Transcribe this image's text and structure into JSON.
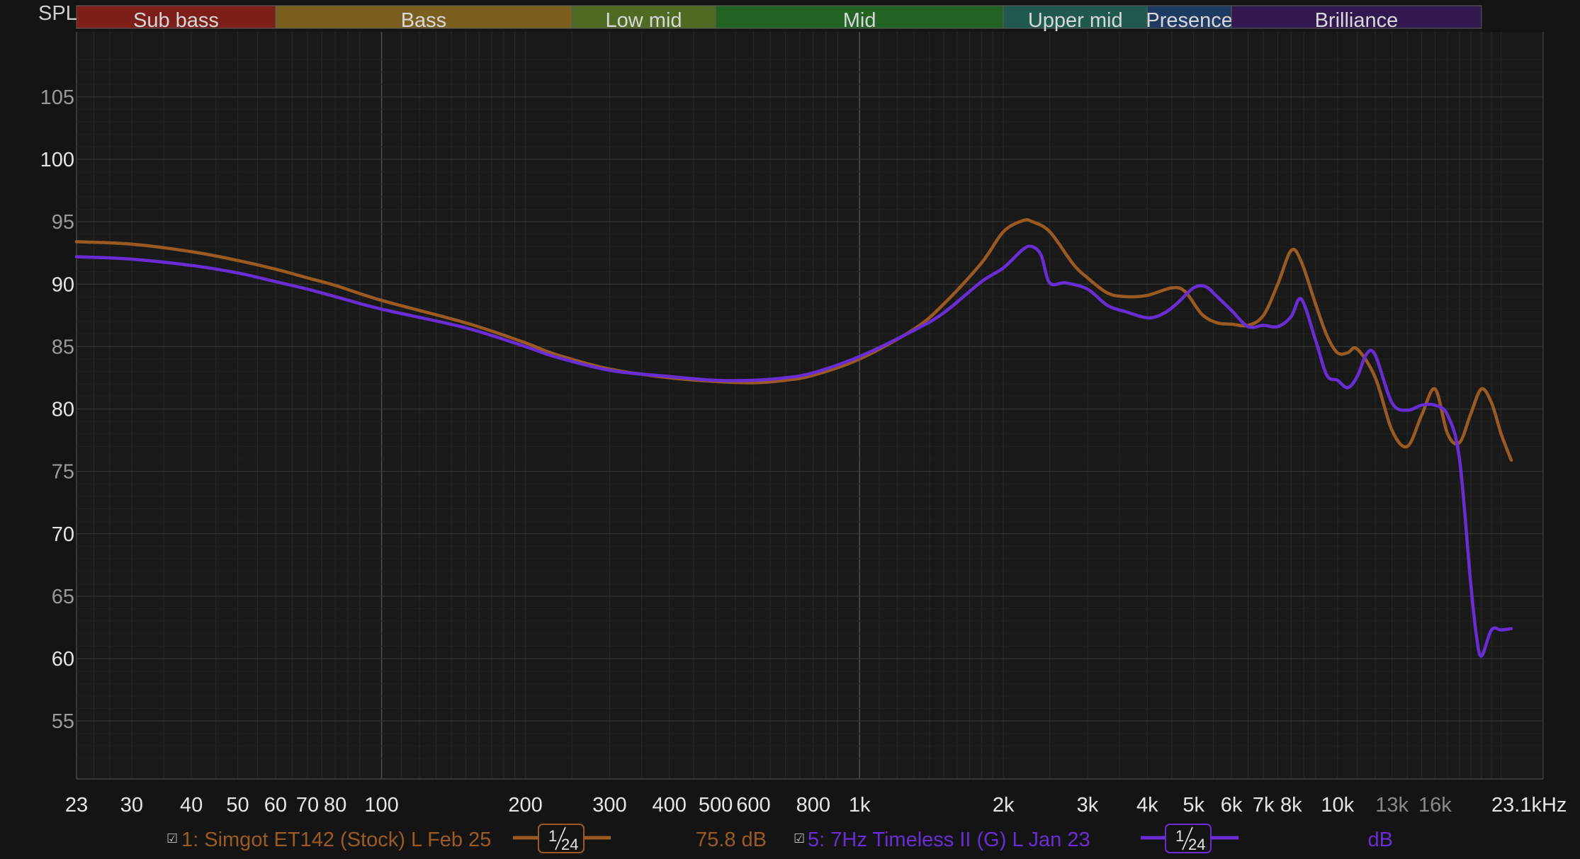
{
  "chart_data": {
    "type": "line",
    "ylabel": "SPL",
    "x_scale": "log",
    "xlim": [
      23,
      23100
    ],
    "ylim": [
      50,
      110
    ],
    "grid": true,
    "y_ticks": [
      {
        "value": 105,
        "label": "105",
        "bright": false
      },
      {
        "value": 100,
        "label": "100",
        "bright": true
      },
      {
        "value": 95,
        "label": "95",
        "bright": false
      },
      {
        "value": 90,
        "label": "90",
        "bright": true
      },
      {
        "value": 85,
        "label": "85",
        "bright": false
      },
      {
        "value": 80,
        "label": "80",
        "bright": true
      },
      {
        "value": 75,
        "label": "75",
        "bright": false
      },
      {
        "value": 70,
        "label": "70",
        "bright": true
      },
      {
        "value": 65,
        "label": "65",
        "bright": false
      },
      {
        "value": 60,
        "label": "60",
        "bright": true
      },
      {
        "value": 55,
        "label": "55",
        "bright": false
      }
    ],
    "x_ticks": [
      {
        "value": 23,
        "label": "23",
        "dim": false
      },
      {
        "value": 30,
        "label": "30",
        "dim": false
      },
      {
        "value": 40,
        "label": "40",
        "dim": false
      },
      {
        "value": 50,
        "label": "50",
        "dim": false
      },
      {
        "value": 60,
        "label": "60",
        "dim": false
      },
      {
        "value": 70,
        "label": "70",
        "dim": false
      },
      {
        "value": 80,
        "label": "80",
        "dim": false
      },
      {
        "value": 100,
        "label": "100",
        "dim": false
      },
      {
        "value": 200,
        "label": "200",
        "dim": false
      },
      {
        "value": 300,
        "label": "300",
        "dim": false
      },
      {
        "value": 400,
        "label": "400",
        "dim": false
      },
      {
        "value": 500,
        "label": "500",
        "dim": false
      },
      {
        "value": 600,
        "label": "600",
        "dim": false
      },
      {
        "value": 800,
        "label": "800",
        "dim": false
      },
      {
        "value": 1000,
        "label": "1k",
        "dim": false
      },
      {
        "value": 2000,
        "label": "2k",
        "dim": false
      },
      {
        "value": 3000,
        "label": "3k",
        "dim": false
      },
      {
        "value": 4000,
        "label": "4k",
        "dim": false
      },
      {
        "value": 5000,
        "label": "5k",
        "dim": false
      },
      {
        "value": 6000,
        "label": "6k",
        "dim": false
      },
      {
        "value": 7000,
        "label": "7k",
        "dim": false
      },
      {
        "value": 8000,
        "label": "8k",
        "dim": false
      },
      {
        "value": 10000,
        "label": "10k",
        "dim": false
      },
      {
        "value": 13000,
        "label": "13k",
        "dim": true
      },
      {
        "value": 16000,
        "label": "16k",
        "dim": true
      },
      {
        "value": 23100,
        "label": "23.1kHz",
        "dim": false
      }
    ],
    "bands": [
      {
        "name": "Sub bass",
        "from": 23,
        "to": 60,
        "color": "#7c1f18"
      },
      {
        "name": "Bass",
        "from": 60,
        "to": 250,
        "color": "#7a5f1f"
      },
      {
        "name": "Low mid",
        "from": 250,
        "to": 500,
        "color": "#4f6a23"
      },
      {
        "name": "Mid",
        "from": 500,
        "to": 2000,
        "color": "#236323"
      },
      {
        "name": "Upper mid",
        "from": 2000,
        "to": 4000,
        "color": "#205a4e"
      },
      {
        "name": "Presence",
        "from": 4000,
        "to": 6000,
        "color": "#1f3a63"
      },
      {
        "name": "Brilliance",
        "from": 6000,
        "to": 20000,
        "color": "#33184f"
      }
    ],
    "series": [
      {
        "name": "1: Simgot ET142 (Stock) L Feb 25",
        "color": "#9a5a22",
        "smoothing": "1/24",
        "level": "75.8 dB",
        "x": [
          23,
          30,
          40,
          50,
          60,
          70,
          80,
          100,
          150,
          200,
          230,
          300,
          400,
          500,
          600,
          700,
          800,
          1000,
          1300,
          1500,
          1800,
          2000,
          2200,
          2300,
          2500,
          2800,
          3000,
          3300,
          3600,
          4000,
          4500,
          4800,
          5200,
          5600,
          6000,
          6500,
          7000,
          7500,
          8000,
          8400,
          9000,
          9500,
          10000,
          10500,
          11000,
          12000,
          13000,
          14000,
          15000,
          16000,
          17000,
          18000,
          19000,
          20000,
          21000,
          22000,
          23100
        ],
        "y": [
          93.4,
          93.2,
          92.6,
          91.9,
          91.2,
          90.5,
          89.9,
          88.7,
          86.9,
          85.3,
          84.4,
          83.2,
          82.5,
          82.2,
          82.1,
          82.3,
          82.7,
          84.0,
          86.4,
          88.4,
          91.7,
          94.2,
          95.1,
          95.0,
          94.2,
          91.6,
          90.5,
          89.3,
          89.0,
          89.1,
          89.7,
          89.4,
          87.6,
          86.9,
          86.8,
          86.7,
          87.5,
          90.0,
          92.7,
          91.8,
          88.4,
          85.9,
          84.5,
          84.5,
          84.8,
          82.5,
          78.3,
          77.0,
          79.5,
          81.6,
          78.0,
          77.3,
          79.6,
          81.6,
          80.5,
          78.0,
          75.9
        ]
      },
      {
        "name": "5: 7Hz Timeless II (G) L Jan 23",
        "color": "#6a2dd4",
        "smoothing": "1/24",
        "level": "dB",
        "x": [
          23,
          30,
          40,
          50,
          60,
          70,
          80,
          100,
          150,
          200,
          230,
          300,
          400,
          500,
          600,
          700,
          800,
          1000,
          1300,
          1500,
          1800,
          2000,
          2200,
          2300,
          2400,
          2500,
          2700,
          3000,
          3300,
          3600,
          4000,
          4300,
          4600,
          5000,
          5300,
          5600,
          6000,
          6500,
          7000,
          7500,
          8000,
          8400,
          9000,
          9500,
          10000,
          10500,
          11000,
          11500,
          12000,
          13000,
          14000,
          15000,
          16000,
          17000,
          18000,
          19000,
          19500,
          20000,
          21000,
          22000,
          23100
        ],
        "y": [
          92.2,
          92.0,
          91.5,
          90.9,
          90.2,
          89.6,
          89.0,
          88.0,
          86.5,
          85.0,
          84.2,
          83.1,
          82.6,
          82.3,
          82.3,
          82.5,
          82.9,
          84.2,
          86.3,
          87.7,
          90.2,
          91.3,
          92.8,
          93.0,
          92.3,
          90.1,
          90.1,
          89.6,
          88.3,
          87.8,
          87.3,
          87.6,
          88.4,
          89.7,
          89.8,
          89.0,
          87.9,
          86.6,
          86.7,
          86.6,
          87.4,
          88.8,
          85.5,
          82.7,
          82.3,
          81.7,
          82.6,
          84.4,
          84.3,
          80.5,
          79.9,
          80.3,
          80.3,
          79.5,
          76.0,
          66.0,
          62.0,
          60.2,
          62.3,
          62.3,
          62.4
        ]
      }
    ]
  },
  "legend": {
    "row1_checkbox": "☑",
    "row2_checkbox": "☑",
    "smoothing_numerator": "1",
    "smoothing_denominator": "24"
  }
}
